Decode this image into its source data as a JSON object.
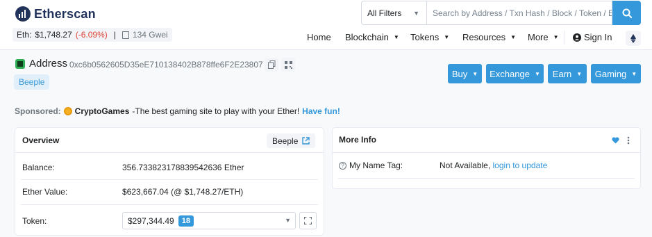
{
  "header": {
    "brand": "Etherscan",
    "eth_price_label": "Eth:",
    "eth_price": "$1,748.27",
    "eth_change": "(-6.09%)",
    "separator": "|",
    "gas": "134 Gwei",
    "filter_selected": "All Filters",
    "search_placeholder": "Search by Address / Txn Hash / Block / Token / Ens",
    "nav": [
      "Home",
      "Blockchain",
      "Tokens",
      "Resources",
      "More"
    ],
    "sign_in": "Sign In"
  },
  "address": {
    "label": "Address",
    "hash": "0xc6b0562605D35eE710138402B878ffe6F2E23807",
    "tag": "Beeple"
  },
  "actions": [
    "Buy",
    "Exchange",
    "Earn",
    "Gaming"
  ],
  "sponsored": {
    "label": "Sponsored:",
    "name": "CryptoGames",
    "text": "-The best gaming site to play with your Ether!",
    "cta": "Have fun!"
  },
  "overview": {
    "title": "Overview",
    "badge": "Beeple",
    "balance_label": "Balance:",
    "balance_value": "356.733823178839542636 Ether",
    "ether_value_label": "Ether Value:",
    "ether_value": "$623,667.04 (@ $1,748.27/ETH)",
    "token_label": "Token:",
    "token_value": "$297,344.49",
    "token_count": "18"
  },
  "more_info": {
    "title": "More Info",
    "name_tag_label": "My Name Tag:",
    "name_tag_value": "Not Available,",
    "name_tag_link": "login to update"
  },
  "colors": {
    "accent": "#3498db",
    "negative": "#de4437",
    "brand": "#21325b"
  },
  "icons": [
    "etherscan-logo-icon",
    "gas-pump-icon",
    "chevron-down-icon",
    "search-icon",
    "user-circle-icon",
    "ethereum-icon",
    "copy-icon",
    "qr-code-icon",
    "crypto-games-icon",
    "external-link-icon",
    "expand-icon",
    "heart-icon",
    "kebab-menu-icon",
    "question-circle-icon"
  ]
}
